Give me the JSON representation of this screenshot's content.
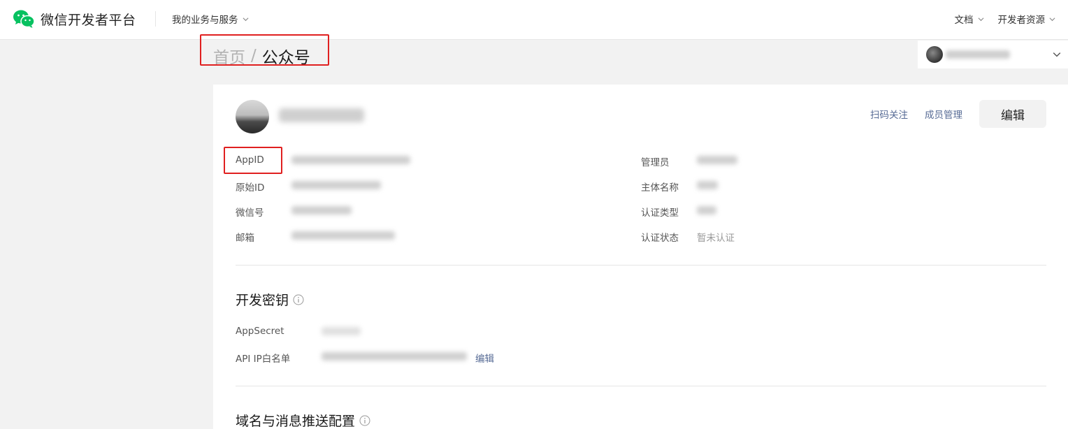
{
  "header": {
    "brand": "微信开发者平台",
    "biz_menu": "我的业务与服务",
    "docs_menu": "文档",
    "resources_menu": "开发者资源"
  },
  "breadcrumb": {
    "home": "首页",
    "separator": "/",
    "current": "公众号"
  },
  "profile": {
    "scan_follow": "扫码关注",
    "member_manage": "成员管理",
    "edit": "编辑"
  },
  "info": {
    "left": [
      {
        "label": "AppID"
      },
      {
        "label": "原始ID"
      },
      {
        "label": "微信号"
      },
      {
        "label": "邮箱"
      }
    ],
    "right": [
      {
        "label": "管理员"
      },
      {
        "label": "主体名称"
      },
      {
        "label": "认证类型"
      },
      {
        "label": "认证状态",
        "value": "暂未认证"
      }
    ]
  },
  "dev_key": {
    "title": "开发密钥",
    "appsecret_label": "AppSecret",
    "ip_whitelist_label": "API IP白名单",
    "ip_edit": "编辑"
  },
  "domain_section": {
    "title": "域名与消息推送配置"
  },
  "colors": {
    "wechat_green": "#07c160",
    "link": "#576b95",
    "highlight_red": "#e02020"
  },
  "icons": {
    "logo": "wechat-logo-icon",
    "chevron": "chevron-down-icon",
    "info": "info-circle-icon"
  }
}
